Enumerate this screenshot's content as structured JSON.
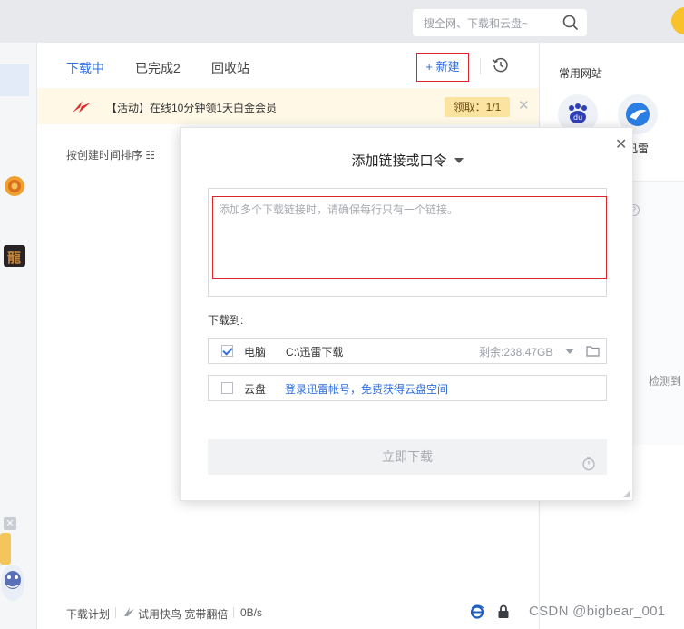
{
  "search": {
    "placeholder": "搜全网、下载和云盘~"
  },
  "tabs": [
    {
      "label": "下载中"
    },
    {
      "label": "已完成2"
    },
    {
      "label": "回收站"
    }
  ],
  "toolbar": {
    "new_label": "+ 新建"
  },
  "banner": {
    "text": "【活动】在线10分钟领1天白金会员",
    "claim_label": "领取：1/1",
    "close": "✕"
  },
  "sort": {
    "label": "按创建时间排序 ☷"
  },
  "modal": {
    "title": "添加链接或口令",
    "close": "✕",
    "input_placeholder": "添加多个下载链接时，请确保每行只有一个链接。",
    "download_to_label": "下载到:",
    "pc": {
      "label": "电脑",
      "path": "C:\\迅雷下载",
      "free_space": "剩余:238.47GB",
      "checked": true
    },
    "cloud": {
      "label": "云盘",
      "link": "登录迅雷帐号，免费获得云盘空间",
      "checked": false
    },
    "start_label": "立即下载"
  },
  "footer": {
    "plan": "下载计划",
    "trial": "试用快鸟 宽带翻倍",
    "speed": "0B/s"
  },
  "rightpanel": {
    "title": "常用网站",
    "site_label": "迅雷",
    "detect_text": "检测到"
  },
  "watermark": "CSDN @bigbear_001",
  "colors": {
    "accent": "#2f6fe0",
    "highlight_border": "#d9262c",
    "banner_bg": "#fff8e6"
  }
}
